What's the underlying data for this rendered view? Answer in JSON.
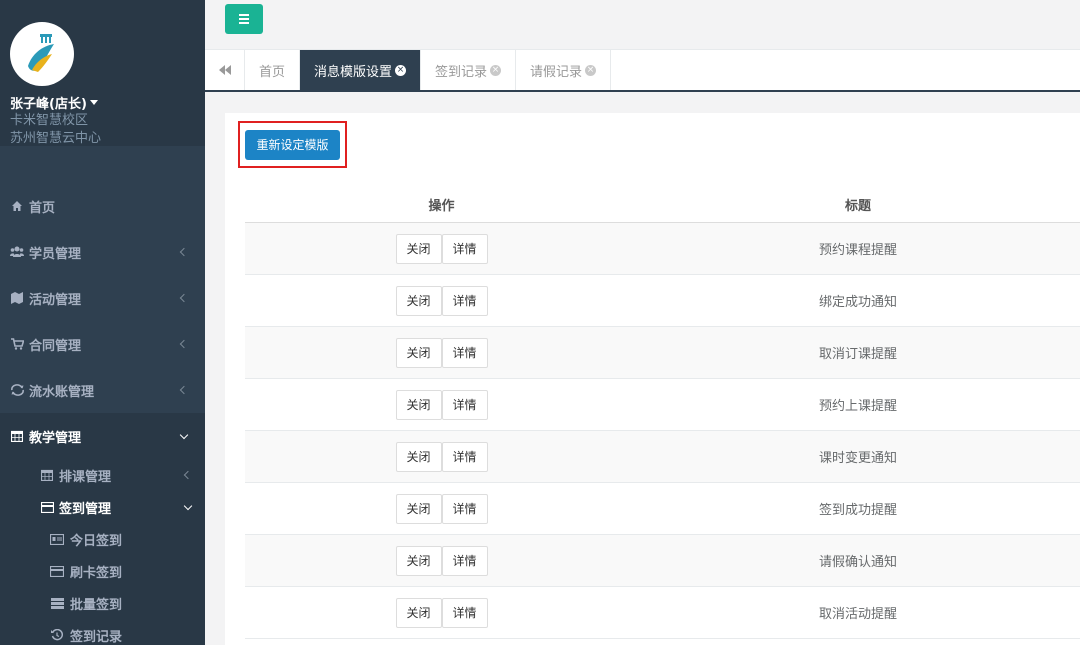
{
  "profile": {
    "name": "张子峰(店长)",
    "school": "卡米智慧校区",
    "center": "苏州智慧云中心"
  },
  "nav": {
    "items": [
      {
        "label": "首页",
        "icon": "home-icon"
      },
      {
        "label": "学员管理",
        "icon": "users-icon"
      },
      {
        "label": "活动管理",
        "icon": "map-icon"
      },
      {
        "label": "合同管理",
        "icon": "cart-icon"
      },
      {
        "label": "流水账管理",
        "icon": "refresh-icon"
      }
    ],
    "teaching": {
      "label": "教学管理",
      "icon": "calendar-icon"
    },
    "sub": {
      "schedule": "排课管理",
      "checkin": "签到管理",
      "checkin_items": [
        "今日签到",
        "刷卡签到",
        "批量签到",
        "签到记录"
      ]
    }
  },
  "tabs": [
    {
      "label": "首页",
      "active": false,
      "closable": false
    },
    {
      "label": "消息模版设置",
      "active": true,
      "closable": true
    },
    {
      "label": "签到记录",
      "active": false,
      "closable": true
    },
    {
      "label": "请假记录",
      "active": false,
      "closable": true
    }
  ],
  "toolbar": {
    "reset_label": "重新设定模版"
  },
  "table": {
    "headers": {
      "op": "操作",
      "title": "标题"
    },
    "close_label": "关闭",
    "detail_label": "详情",
    "rows": [
      "预约课程提醒",
      "绑定成功通知",
      "取消订课提醒",
      "预约上课提醒",
      "课时变更通知",
      "签到成功提醒",
      "请假确认通知",
      "取消活动提醒"
    ]
  },
  "colors": {
    "sidebar": "#2f4050",
    "accent": "#1ab394",
    "primary": "#1c84c6",
    "highlight": "#e02020"
  }
}
